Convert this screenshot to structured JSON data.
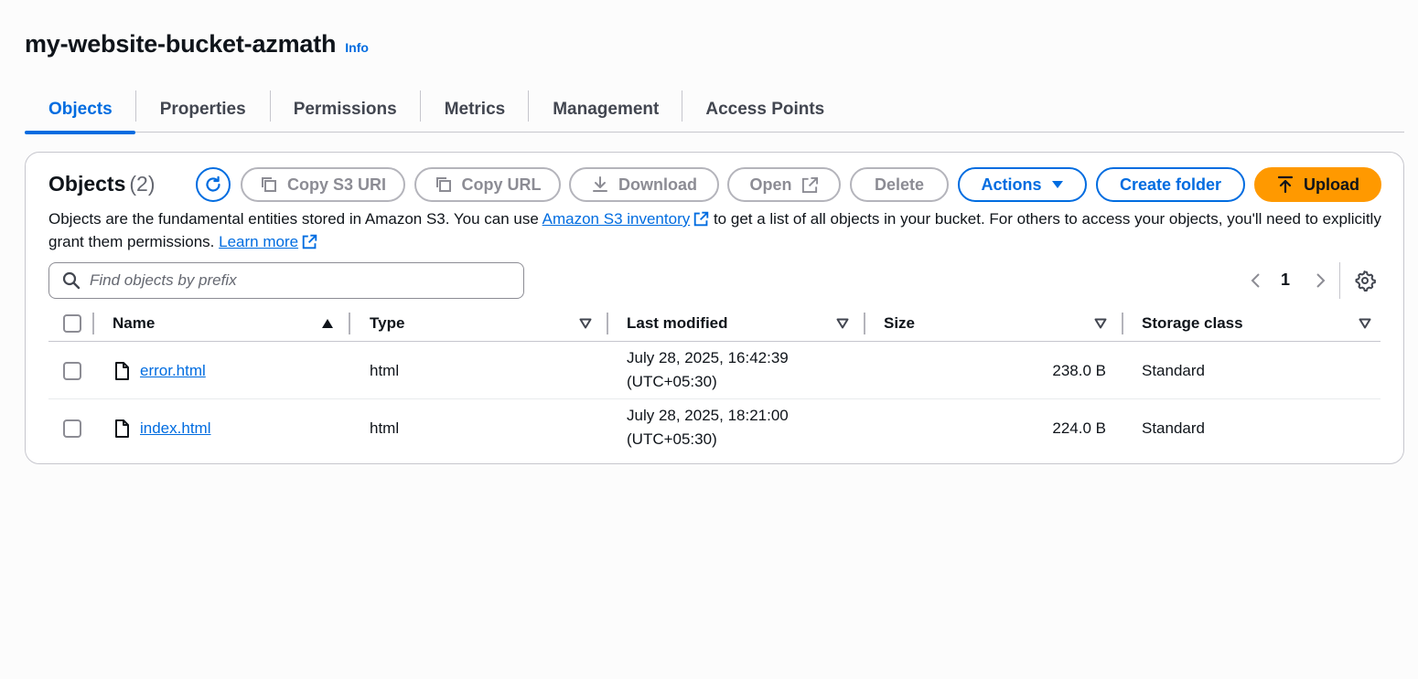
{
  "header": {
    "title": "my-website-bucket-azmath",
    "info": "Info"
  },
  "tabs": [
    {
      "label": "Objects",
      "active": true
    },
    {
      "label": "Properties"
    },
    {
      "label": "Permissions"
    },
    {
      "label": "Metrics"
    },
    {
      "label": "Management"
    },
    {
      "label": "Access Points"
    }
  ],
  "objects": {
    "title": "Objects",
    "count": "(2)",
    "buttons": {
      "copy_s3_uri": "Copy S3 URI",
      "copy_url": "Copy URL",
      "download": "Download",
      "open": "Open",
      "delete": "Delete",
      "actions": "Actions",
      "create_folder": "Create folder",
      "upload": "Upload"
    },
    "description": {
      "part1": "Objects are the fundamental entities stored in Amazon S3. You can use ",
      "inventory_link": "Amazon S3 inventory",
      "part2": " to get a list of all objects in your bucket. For others to access your objects, you'll need to explicitly grant them permissions. ",
      "learn_more": "Learn more"
    },
    "search": {
      "placeholder": "Find objects by prefix"
    },
    "pagination": {
      "current_page": "1"
    },
    "columns": [
      "Name",
      "Type",
      "Last modified",
      "Size",
      "Storage class"
    ],
    "rows": [
      {
        "name": "error.html",
        "type": "html",
        "modified_date": "July 28, 2025, 16:42:39",
        "modified_tz": "(UTC+05:30)",
        "size": "238.0 B",
        "storage_class": "Standard"
      },
      {
        "name": "index.html",
        "type": "html",
        "modified_date": "July 28, 2025, 18:21:00",
        "modified_tz": "(UTC+05:30)",
        "size": "224.0 B",
        "storage_class": "Standard"
      }
    ]
  },
  "colors": {
    "accent": "#006ce0",
    "upload": "#ff9900",
    "disabled": "#8c8c94"
  },
  "icons": [
    "refresh-icon",
    "copy-icon",
    "download-icon",
    "external-link-icon",
    "caret-down-icon",
    "upload-icon",
    "search-icon",
    "chevron-left-icon",
    "chevron-right-icon",
    "settings-icon",
    "file-icon",
    "sort-ascending-icon",
    "sort-icon"
  ]
}
